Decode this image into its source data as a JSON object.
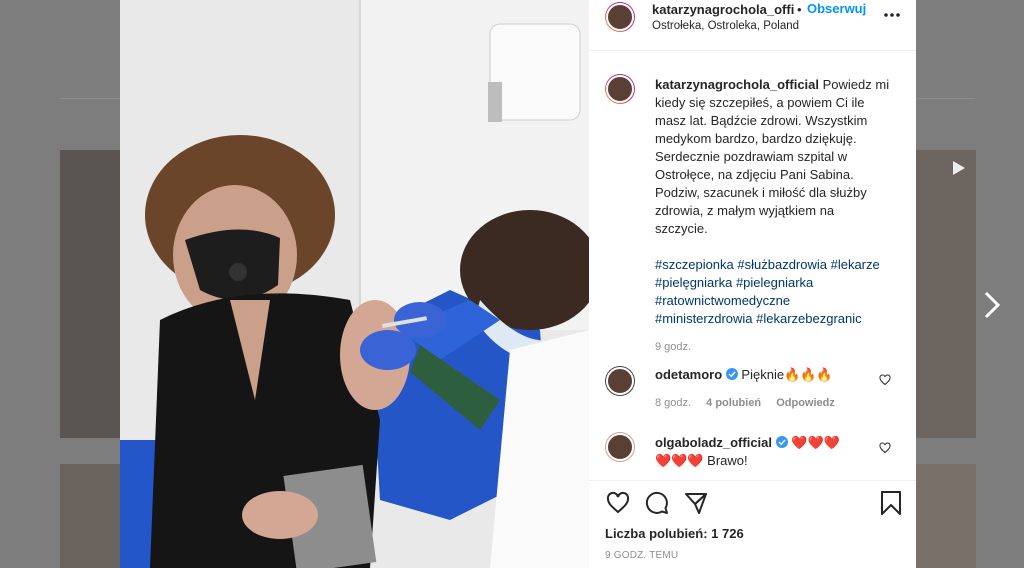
{
  "post": {
    "username": "katarzynagrochola_offi",
    "dot": "•",
    "follow_label": "Obserwuj",
    "location": "Ostrołeka, Ostroleka, Poland",
    "caption": {
      "username": "katarzynagrochola_official",
      "lines": [
        "Powiedz mi",
        "kiedy się szczepiłeś, a powiem Ci ile",
        "masz lat. Bądźcie zdrowi. Wszystkim",
        "medykom bardzo, bardzo dziękuję.",
        "Serdecznie pozdrawiam szpital w",
        "Ostrołęce, na zdjęciu Pani Sabina.",
        "Podziw, szacunek i miłość dla służby",
        "zdrowia, z małym wyjątkiem na",
        "szczycie."
      ],
      "hashtags": [
        "#szczepionka #służbazdrowia #lekarze",
        "#pielęgniarka #pielegniarka",
        "#ratownictwomedyczne",
        "#ministerzdrowia #lekarzebezgranic"
      ],
      "time": "9 godz."
    },
    "comments": [
      {
        "username": "odetamoro",
        "text": "Pięknie🔥🔥🔥",
        "time": "8 godz.",
        "likes": "4 polubień",
        "reply": "Odpowiedz"
      },
      {
        "username": "olgaboladz_official",
        "text_line1": "❤️❤️❤️",
        "text_line2": "❤️❤️❤️ Brawo!"
      }
    ],
    "likes_label": "Liczba polubień: 1 726",
    "timestamp": "9 GODZ. TEMU"
  },
  "colors": {
    "accent": "#0095f6",
    "verified": "#3897f0",
    "heart": "#ed4956"
  }
}
